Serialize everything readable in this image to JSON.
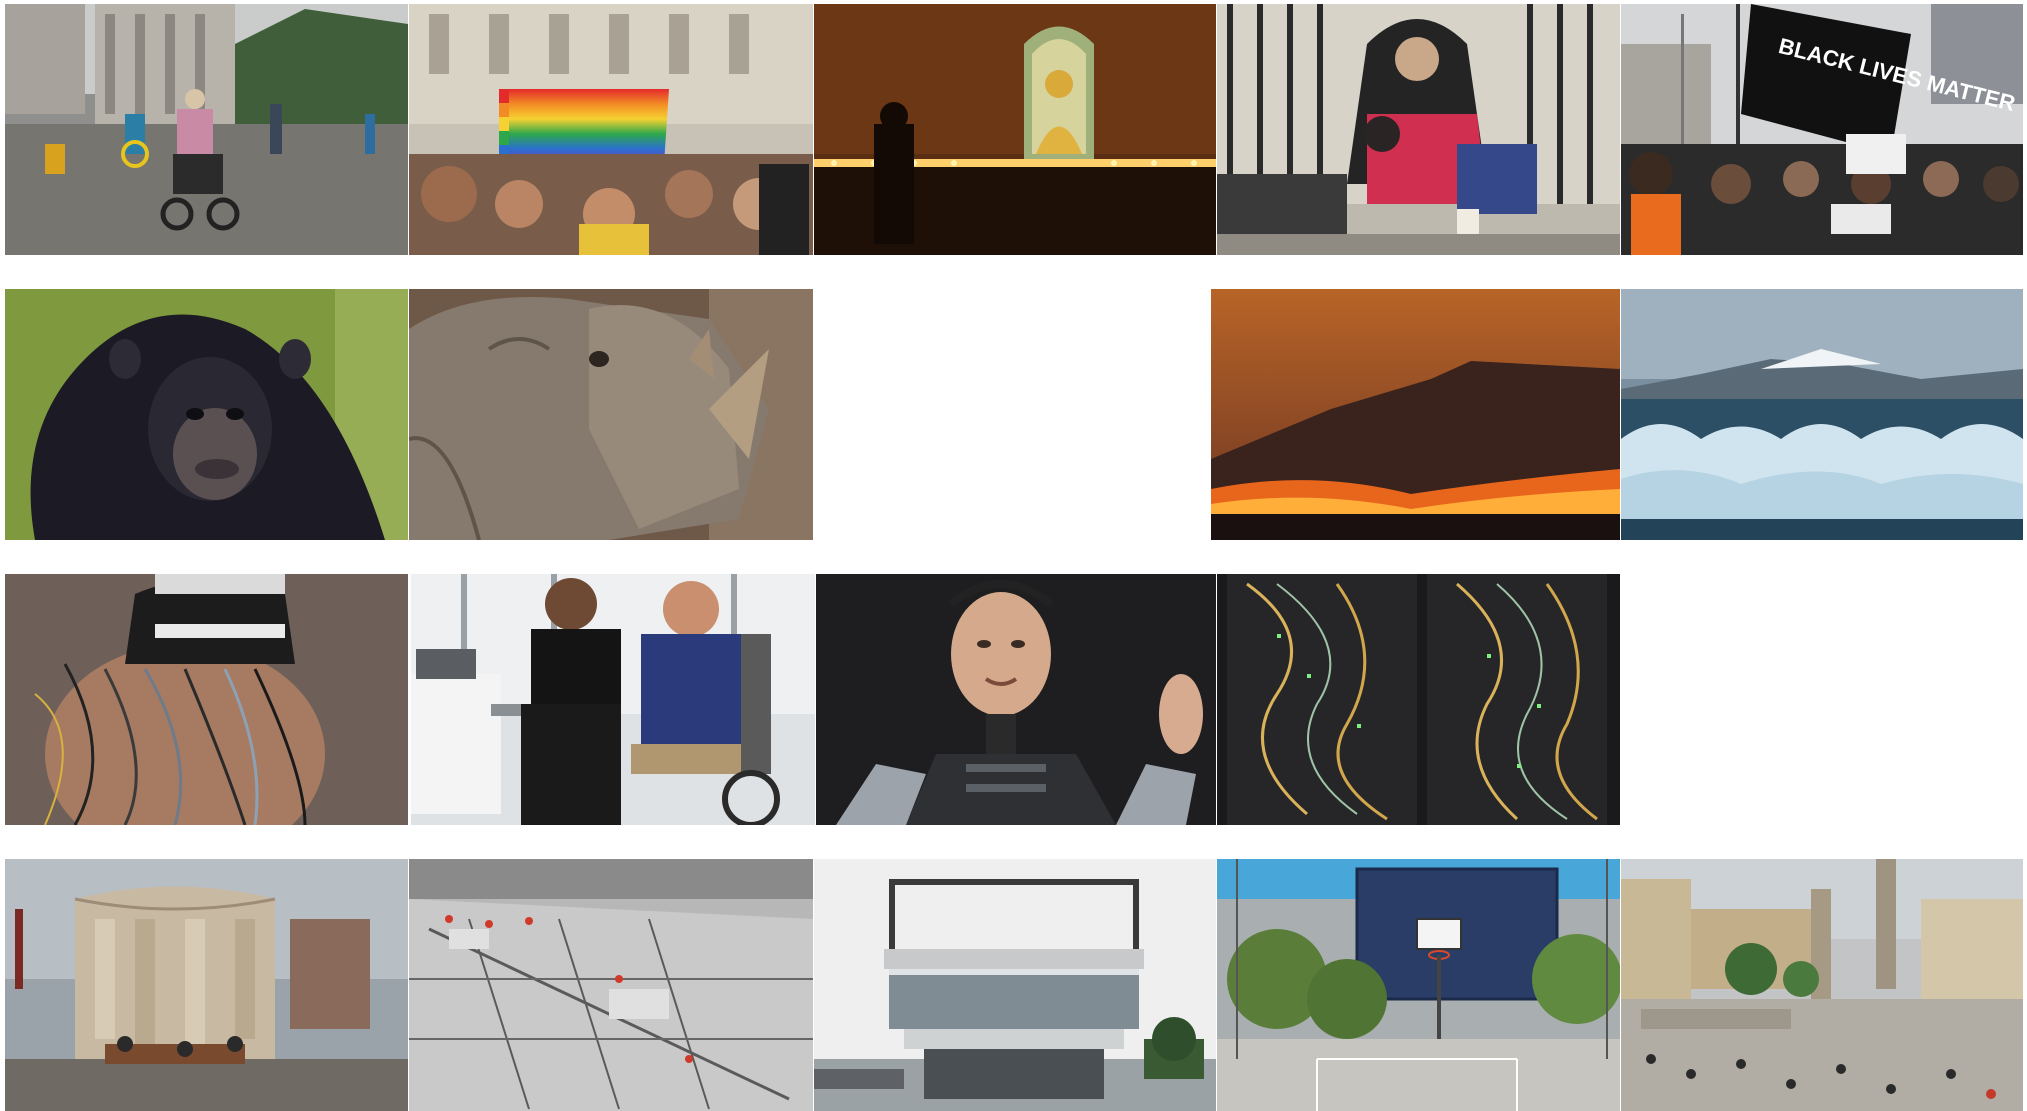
{
  "gallery": {
    "tiles": [
      {
        "row": 1,
        "col": 1,
        "icon": "wheelchair-street-photo"
      },
      {
        "row": 1,
        "col": 2,
        "icon": "pride-crowd-photo"
      },
      {
        "row": 1,
        "col": 3,
        "icon": "buddha-shrine-photo"
      },
      {
        "row": 1,
        "col": 4,
        "icon": "homeless-dog-photo"
      },
      {
        "row": 1,
        "col": 5,
        "icon": "blm-protest-photo",
        "sign_text": "BLACK LIVES MATTER"
      },
      {
        "row": 2,
        "col": 1,
        "icon": "chimpanzee-photo"
      },
      {
        "row": 2,
        "col": 2,
        "icon": "rhino-photo"
      },
      {
        "row": 2,
        "col": 4,
        "icon": "wildfire-mountain-photo"
      },
      {
        "row": 2,
        "col": 5,
        "icon": "glacier-icebergs-photo"
      },
      {
        "row": 3,
        "col": 1,
        "icon": "vr-headset-wires-photo"
      },
      {
        "row": 3,
        "col": 2,
        "icon": "prosthetic-arm-office-photo"
      },
      {
        "row": 3,
        "col": 3,
        "icon": "humanoid-robot-photo"
      },
      {
        "row": 3,
        "col": 4,
        "icon": "server-racks-photo"
      },
      {
        "row": 4,
        "col": 1,
        "icon": "cylindrical-pavilion-photo"
      },
      {
        "row": 4,
        "col": 2,
        "icon": "construction-aerial-photo"
      },
      {
        "row": 4,
        "col": 3,
        "icon": "modern-building-photo"
      },
      {
        "row": 4,
        "col": 4,
        "icon": "basketball-court-photo"
      },
      {
        "row": 4,
        "col": 5,
        "icon": "trafalgar-square-photo"
      }
    ]
  },
  "colors": {
    "background": "#ffffff",
    "fire_orange": "#e8661c",
    "protest_black": "#111111",
    "glacier_ice": "#cfe4ee"
  }
}
